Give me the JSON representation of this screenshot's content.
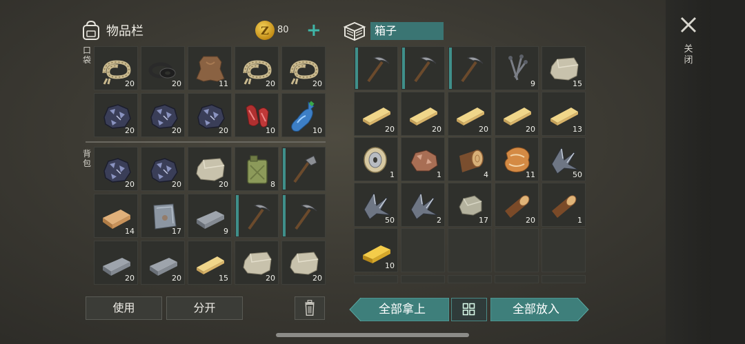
{
  "inventory": {
    "title": "物品栏",
    "coins": "80",
    "coin_symbol": "Z",
    "plus": "+",
    "pocket_label": "口袋",
    "backpack_label": "背包"
  },
  "pocket": [
    {
      "item": "rope",
      "count": "20"
    },
    {
      "item": "rubber-seals",
      "count": "20"
    },
    {
      "item": "leather-hide",
      "count": "11"
    },
    {
      "item": "rope",
      "count": "20"
    },
    {
      "item": "rope",
      "count": "20"
    },
    {
      "item": "coal-ore",
      "count": "20"
    },
    {
      "item": "coal-ore",
      "count": "20"
    },
    {
      "item": "coal-ore",
      "count": "20"
    },
    {
      "item": "raw-meat",
      "count": "10"
    },
    {
      "item": "plastic-bottle",
      "count": "10"
    }
  ],
  "backpack": [
    {
      "item": "coal-ore",
      "count": "20"
    },
    {
      "item": "coal-ore",
      "count": "20"
    },
    {
      "item": "limestone",
      "count": "20"
    },
    {
      "item": "fuel-canister",
      "count": "8"
    },
    {
      "item": "hatchet",
      "count": ""
    },
    {
      "item": "wooden-plank",
      "count": "14"
    },
    {
      "item": "metal-plate",
      "count": "17"
    },
    {
      "item": "iron-ingot",
      "count": "9"
    },
    {
      "item": "pickaxe",
      "count": ""
    },
    {
      "item": "pickaxe",
      "count": ""
    },
    {
      "item": "iron-ingot",
      "count": "20"
    },
    {
      "item": "iron-ingot",
      "count": "20"
    },
    {
      "item": "board",
      "count": "15"
    },
    {
      "item": "limestone",
      "count": "20"
    },
    {
      "item": "limestone",
      "count": "20"
    }
  ],
  "box": {
    "title": "箱子",
    "slots": [
      {
        "item": "pickaxe",
        "count": ""
      },
      {
        "item": "pickaxe",
        "count": ""
      },
      {
        "item": "pickaxe",
        "count": ""
      },
      {
        "item": "nails",
        "count": "9"
      },
      {
        "item": "limestone",
        "count": "15"
      },
      {
        "item": "board",
        "count": "20"
      },
      {
        "item": "board",
        "count": "20"
      },
      {
        "item": "board",
        "count": "20"
      },
      {
        "item": "board",
        "count": "20"
      },
      {
        "item": "board",
        "count": "13"
      },
      {
        "item": "wire-spool",
        "count": "1"
      },
      {
        "item": "copper-ore",
        "count": "1"
      },
      {
        "item": "wood-log",
        "count": "4"
      },
      {
        "item": "fox-fur",
        "count": "11"
      },
      {
        "item": "iron-ore",
        "count": "50"
      },
      {
        "item": "iron-ore",
        "count": "50"
      },
      {
        "item": "iron-ore",
        "count": "2"
      },
      {
        "item": "stone",
        "count": "17"
      },
      {
        "item": "firewood",
        "count": "20"
      },
      {
        "item": "firewood",
        "count": "1"
      },
      {
        "item": "gold-ingot",
        "count": "10"
      },
      {
        "item": "",
        "count": ""
      },
      {
        "item": "",
        "count": ""
      },
      {
        "item": "",
        "count": ""
      },
      {
        "item": "",
        "count": ""
      }
    ]
  },
  "buttons": {
    "use": "使用",
    "split": "分开",
    "take_all": "全部拿上",
    "put_all": "全部放入",
    "close": "关闭"
  },
  "colors": {
    "accent": "#3e7f7b",
    "durability": "#3f8f8a",
    "coin": "#e0b030"
  }
}
